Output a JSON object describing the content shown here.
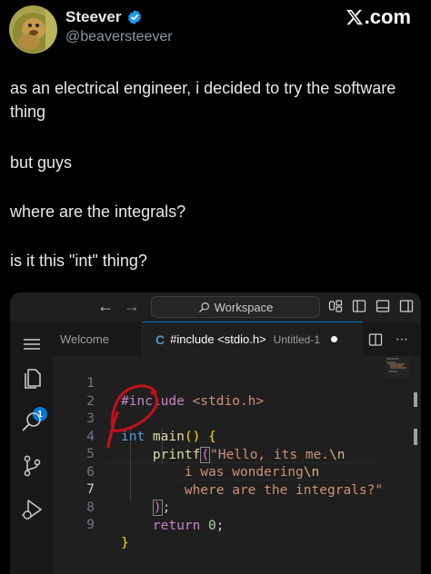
{
  "tweet": {
    "display_name": "Steever",
    "handle": "@beaversteever",
    "brand": ".com",
    "paragraphs": [
      "as an electrical engineer, i decided to try the software thing",
      "but guys",
      "where are the integrals?",
      "is it this \"int\" thing?"
    ]
  },
  "vscode": {
    "command_center": "Workspace",
    "tabs": {
      "welcome": "Welcome",
      "active_icon": "C",
      "active_label": "#include <stdio.h>",
      "active_sub": "Untitled-1"
    },
    "badge_count": "1",
    "line_numbers": [
      "1",
      "2",
      "3",
      "4",
      "5",
      "6",
      "7",
      "8",
      "9"
    ],
    "active_line": "7",
    "code": {
      "l1_kw": "#include",
      "l1_hdr": " <stdio.h>",
      "l3_type": "int",
      "l3_rest": " main",
      "l3_parens": "()",
      "l3_brace": " {",
      "l4_fn": "printf",
      "l4_paren": "(",
      "l4_str": "\"Hello, its me.",
      "l4_esc": "\\n",
      "l5_str": "i was wondering",
      "l5_esc": "\\n",
      "l6_str": "where are the integrals?\"",
      "l7_paren": ")",
      "l7_semi": ";",
      "l8_kw": "return",
      "l8_num": " 0",
      "l8_semi": ";",
      "l9_brace": "}"
    },
    "icons": [
      "arrow-left-icon",
      "arrow-right-icon",
      "search-icon",
      "copilot-icon",
      "toggle-sidebar-icon",
      "toggle-panel-icon",
      "toggle-secondary-sidebar-icon",
      "menu-icon",
      "explorer-icon",
      "search-icon",
      "source-control-icon",
      "run-debug-icon",
      "split-editor-icon",
      "more-actions-icon"
    ]
  },
  "colors": {
    "background": "#000000",
    "verified_blue": "#1d9bf0",
    "vscode_accent": "#0078d4",
    "annotation_red": "#c8101a"
  }
}
